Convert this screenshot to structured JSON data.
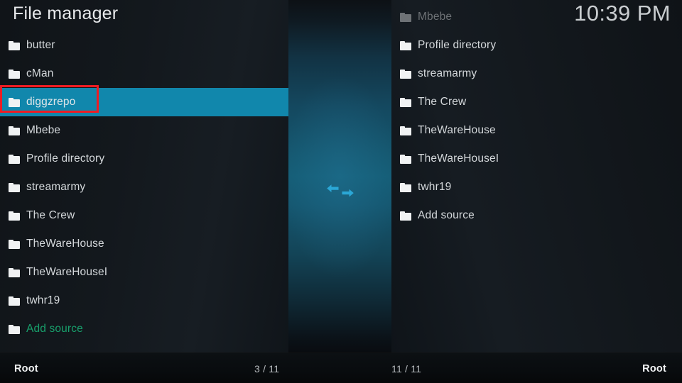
{
  "header": {
    "title": "File manager",
    "clock": "10:39 PM"
  },
  "colors": {
    "selection": "#1187ac",
    "accent_green": "#18a06c",
    "highlight_box": "#ef1c23",
    "divider_teal": "#155d76",
    "text": "#d4d8db"
  },
  "divider": {
    "icon_name": "swap-panels-icon"
  },
  "left_panel": {
    "focused": true,
    "selected_index": 2,
    "items": [
      {
        "label": "butter",
        "icon": "folder-icon",
        "style": "normal"
      },
      {
        "label": "cMan",
        "icon": "folder-icon",
        "style": "normal"
      },
      {
        "label": "diggzrepo",
        "icon": "folder-icon",
        "style": "selected"
      },
      {
        "label": "Mbebe",
        "icon": "folder-icon",
        "style": "normal"
      },
      {
        "label": "Profile directory",
        "icon": "folder-icon",
        "style": "normal"
      },
      {
        "label": "streamarmy",
        "icon": "folder-icon",
        "style": "normal"
      },
      {
        "label": "The Crew",
        "icon": "folder-icon",
        "style": "normal"
      },
      {
        "label": "TheWareHouse",
        "icon": "folder-icon",
        "style": "normal"
      },
      {
        "label": "TheWareHouseI",
        "icon": "folder-icon",
        "style": "normal"
      },
      {
        "label": "twhr19",
        "icon": "folder-icon",
        "style": "normal"
      },
      {
        "label": "Add source",
        "icon": "folder-icon",
        "style": "accent"
      }
    ],
    "status": {
      "path": "Root",
      "count": "3 / 11"
    }
  },
  "right_panel": {
    "focused": false,
    "items": [
      {
        "label": "Mbebe",
        "icon": "folder-icon",
        "style": "dim"
      },
      {
        "label": "Profile directory",
        "icon": "folder-icon",
        "style": "normal"
      },
      {
        "label": "streamarmy",
        "icon": "folder-icon",
        "style": "normal"
      },
      {
        "label": "The Crew",
        "icon": "folder-icon",
        "style": "normal"
      },
      {
        "label": "TheWareHouse",
        "icon": "folder-icon",
        "style": "normal"
      },
      {
        "label": "TheWareHouseI",
        "icon": "folder-icon",
        "style": "normal"
      },
      {
        "label": "twhr19",
        "icon": "folder-icon",
        "style": "normal"
      },
      {
        "label": "Add source",
        "icon": "folder-icon",
        "style": "normal"
      }
    ],
    "status": {
      "path": "Root",
      "count": "11 / 11"
    }
  }
}
